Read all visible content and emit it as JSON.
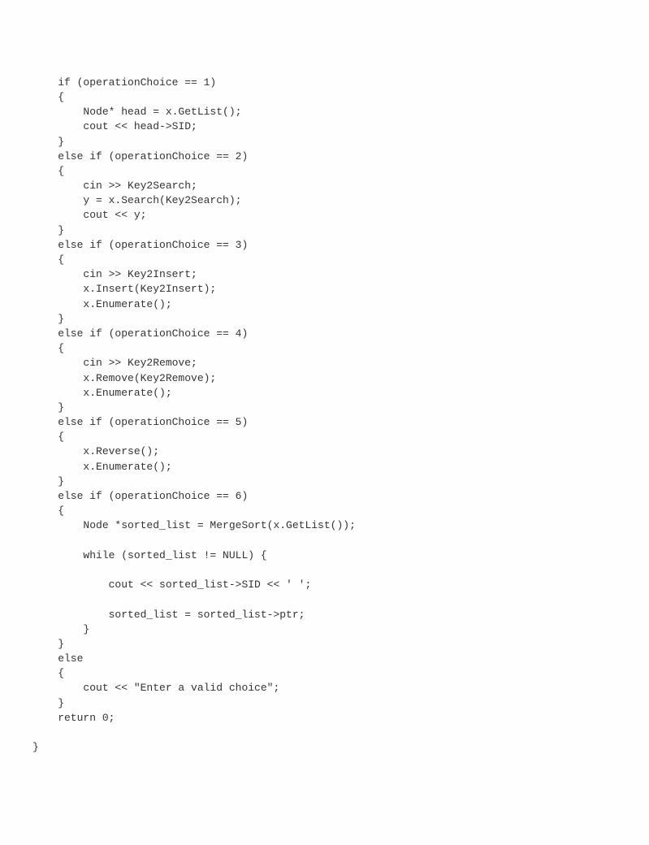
{
  "code": {
    "lines": [
      "    if (operationChoice == 1)",
      "    {",
      "        Node* head = x.GetList();",
      "        cout << head->SID;",
      "    }",
      "    else if (operationChoice == 2)",
      "    {",
      "        cin >> Key2Search;",
      "        y = x.Search(Key2Search);",
      "        cout << y;",
      "    }",
      "    else if (operationChoice == 3)",
      "    {",
      "        cin >> Key2Insert;",
      "        x.Insert(Key2Insert);",
      "        x.Enumerate();",
      "    }",
      "    else if (operationChoice == 4)",
      "    {",
      "        cin >> Key2Remove;",
      "        x.Remove(Key2Remove);",
      "        x.Enumerate();",
      "    }",
      "    else if (operationChoice == 5)",
      "    {",
      "        x.Reverse();",
      "        x.Enumerate();",
      "    }",
      "    else if (operationChoice == 6)",
      "    {",
      "        Node *sorted_list = MergeSort(x.GetList());",
      "",
      "        while (sorted_list != NULL) {",
      "",
      "            cout << sorted_list->SID << ' ';",
      "",
      "            sorted_list = sorted_list->ptr;",
      "        }",
      "    }",
      "    else",
      "    {",
      "        cout << \"Enter a valid choice\";",
      "    }",
      "    return 0;",
      "",
      "}"
    ]
  }
}
